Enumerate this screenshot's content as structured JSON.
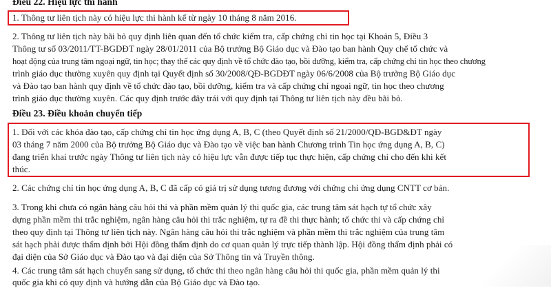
{
  "document": {
    "article22": {
      "heading": "Điều 22. Hiệu lực thi hành",
      "item1": "1.  Thông tư liên tịch này có hiệu lực thi hành kể từ ngày 10 tháng 8 năm 2016.",
      "item2": [
        "2.  Thông tư liên tịch này bãi bỏ quy định liên quan đến tổ chức kiểm tra, cấp chứng chỉ tin học tại Khoản 5, Điều 3",
        "Thông tư số 03/2011/TT-BGDĐT ngày 28/01/2011 của Bộ trưởng Bộ Giáo dục và Đào tạo ban hành Quy chế tổ chức và",
        "hoạt động của trung tâm ngoại ngữ, tin học; thay thế các quy định về tổ chức đào tạo, bồi dưỡng, kiểm tra, cấp chứng chỉ tin học theo chương",
        "trình giáo dục thường xuyên quy định tại Quyết định số 30/2008/QĐ-BGDĐT ngày 06/6/2008 của Bộ trưởng Bộ Giáo dục",
        "và Đào tạo ban hành quy định về tổ chức đào tạo, bồi dưỡng, kiểm tra và cấp chứng chỉ ngoại ngữ, tin học theo chương",
        "trình giáo dục thường xuyên. Các quy định trước đây trái với quy định tại Thông tư liên tịch này đều bãi bỏ."
      ]
    },
    "article23": {
      "heading": "Điều 23. Điều khoản chuyển tiếp",
      "item1": [
        "1.  Đối với các khóa đào tạo, cấp chứng chỉ tin học ứng dụng A, B, C (theo Quyết định số 21/2000/QĐ-BGD&ĐT ngày",
        "03 tháng 7 năm 2000 của Bộ trưởng Bộ Giáo dục và Đào tạo về việc ban hành Chương trình Tin học ứng dụng A, B, C)",
        "đang triển khai trước ngày Thông tư liên tịch này có hiệu lực vẫn được tiếp tục thực hiện, cấp chứng chỉ cho đến khi kết",
        "thúc."
      ],
      "item2": "2.  Các chứng chỉ tin học ứng dụng A, B, C đã cấp có giá trị sử dụng tương đương với chứng chỉ ứng dụng CNTT cơ bản.",
      "item3": [
        "3.  Trong khi chưa có ngân hàng câu hỏi thi và phần mềm quản lý thi quốc gia, các trung tâm sát hạch tự tổ chức xây",
        "dựng phần mềm thi trắc nghiệm, ngân hàng câu hỏi thi trắc nghiệm, tự ra đề thi thực hành; tổ chức thi và cấp chứng chỉ",
        "theo quy định tại Thông tư liên tịch này. Ngân hàng câu hỏi thi trắc nghiệm và phần mềm thi trắc nghiệm của trung tâm",
        "sát hạch phải được thẩm định bởi Hội đồng thẩm định do cơ quan quản lý trực tiếp thành lập. Hội đồng thẩm định phải có",
        "đại diện của Sở Giáo dục và Đào tạo và đại diện của Sở Thông tin và Truyền thông."
      ],
      "item4": [
        "4.  Các trung tâm sát hạch chuyển sang sử dụng, tổ chức thi theo ngân hàng câu hỏi thi quốc gia, phần mềm quản lý thi",
        "quốc gia khi có quy định và hướng dẫn của Bộ Giáo dục và Đào tạo."
      ]
    },
    "highlight_color": "#e11b22"
  }
}
